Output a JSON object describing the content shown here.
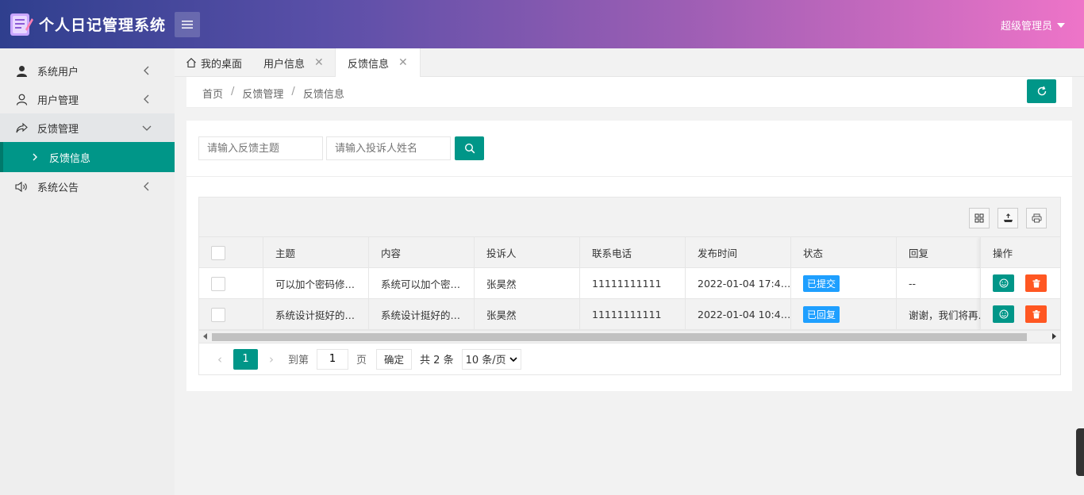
{
  "header": {
    "app_title": "个人日记管理系统",
    "user_name": "超级管理员"
  },
  "sidebar": {
    "items": [
      {
        "label": "系统用户",
        "icon": "user-filled-icon"
      },
      {
        "label": "用户管理",
        "icon": "user-outline-icon"
      },
      {
        "label": "反馈管理",
        "icon": "share-icon"
      },
      {
        "label": "系统公告",
        "icon": "speaker-icon"
      }
    ],
    "sub_item": {
      "label": "反馈信息"
    }
  },
  "tabs": [
    {
      "label": "我的桌面"
    },
    {
      "label": "用户信息"
    },
    {
      "label": "反馈信息"
    }
  ],
  "breadcrumb": {
    "items": [
      "首页",
      "反馈管理",
      "反馈信息"
    ],
    "separator": "/"
  },
  "search": {
    "topic_placeholder": "请输入反馈主题",
    "name_placeholder": "请输入投诉人姓名"
  },
  "table": {
    "columns": [
      "主题",
      "内容",
      "投诉人",
      "联系电话",
      "发布时间",
      "状态",
      "回复",
      "操作"
    ],
    "rows": [
      {
        "topic": "可以加个密码修…",
        "content": "系统可以加个密…",
        "author": "张昊然",
        "phone": "11111111111",
        "time": "2022-01-04 17:4…",
        "status": "已提交",
        "reply": "--"
      },
      {
        "topic": "系统设计挺好的…",
        "content": "系统设计挺好的…",
        "author": "张昊然",
        "phone": "11111111111",
        "time": "2022-01-04 10:4…",
        "status": "已回复",
        "reply": "谢谢，我们将再…"
      }
    ]
  },
  "pager": {
    "current_page": "1",
    "goto_label": "到第",
    "goto_value": "1",
    "page_unit": "页",
    "confirm_label": "确定",
    "total_label": "共 2 条",
    "page_size": "10 条/页"
  },
  "colors": {
    "primary": "#009688",
    "danger": "#ff5722",
    "badge": "#1e9fff"
  }
}
